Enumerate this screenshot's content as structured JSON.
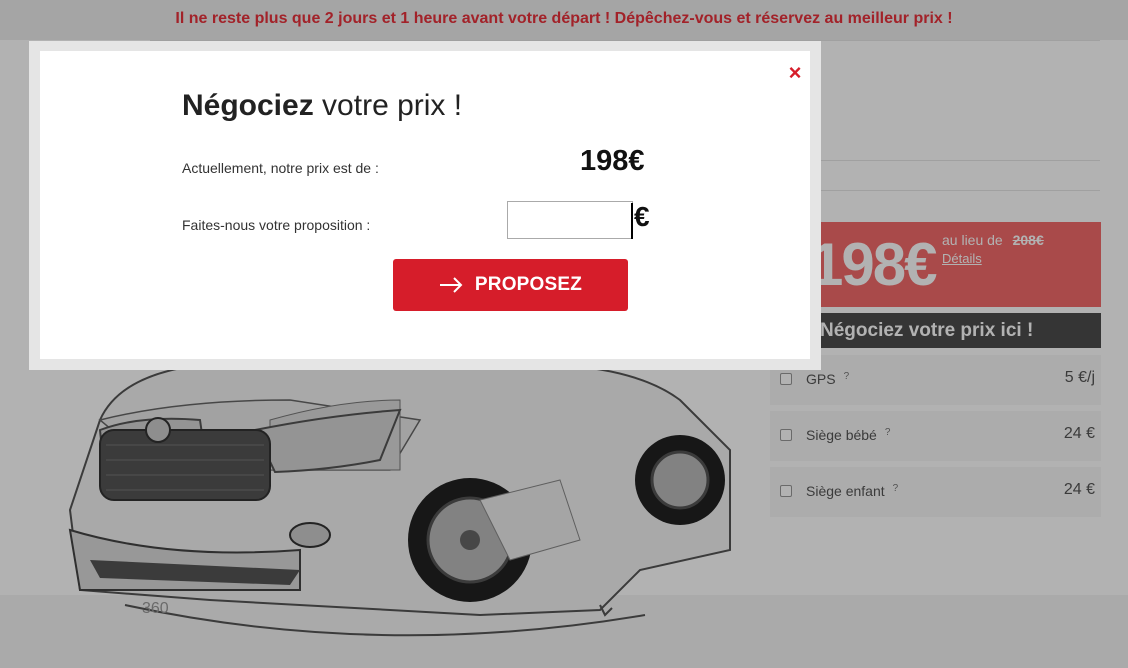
{
  "banner": {
    "text": "Il ne reste plus que 2 jours et 1 heure avant votre départ ! Dépêchez-vous et réservez au meilleur prix !"
  },
  "pricebox": {
    "price": "198€",
    "instead_label": "au lieu de",
    "old_price": "208€",
    "details_link": "Détails"
  },
  "negotiate_bar": {
    "label": "Négociez votre prix ici !"
  },
  "options": [
    {
      "label": "GPS",
      "help": "?",
      "price": "5 €/j",
      "checked": false
    },
    {
      "label": "Siège bébé",
      "help": "?",
      "price": "24 €",
      "checked": false
    },
    {
      "label": "Siège enfant",
      "help": "?",
      "price": "24 €",
      "checked": false
    }
  ],
  "car_viewer": {
    "rotation_label": "360"
  },
  "modal": {
    "title_strong": "Négociez",
    "title_rest": " votre prix !",
    "current_label": "Actuellement, notre prix est de :",
    "current_price": "198€",
    "offer_label": "Faites-nous votre proposition :",
    "offer_value": "",
    "offer_suffix": "€",
    "submit_label": "PROPOSEZ",
    "close_symbol": "×"
  },
  "colors": {
    "accent_red": "#d61d2a",
    "banner_text": "#e8323c",
    "overlay": "rgba(0,0,0,0.3)"
  },
  "icons": {
    "close": "close-icon",
    "submit_arrow": "arrow-right-icon",
    "help": "question-icon"
  }
}
